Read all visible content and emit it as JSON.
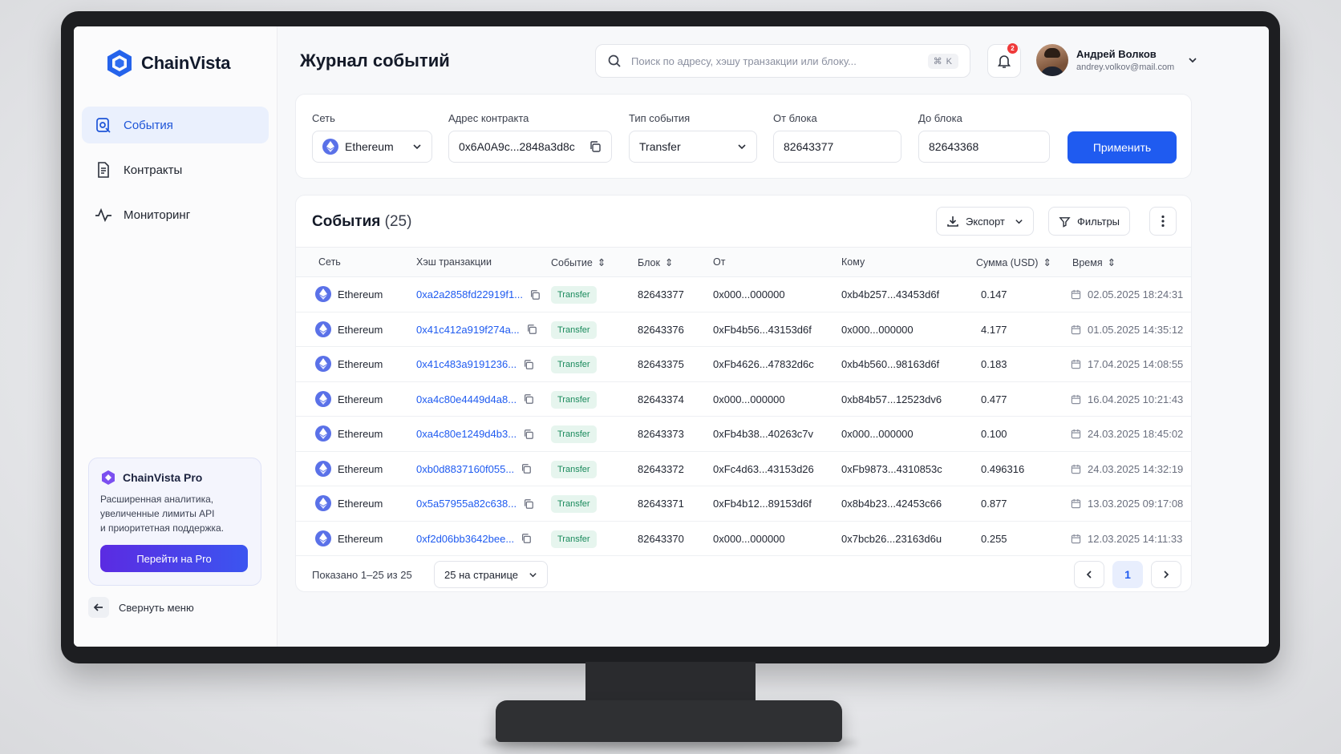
{
  "app": {
    "name": "ChainVista"
  },
  "sidebar": {
    "items": [
      {
        "label": "События",
        "icon": "events-icon",
        "active": true
      },
      {
        "label": "Контракты",
        "icon": "document-icon",
        "active": false
      },
      {
        "label": "Мониторинг",
        "icon": "activity-icon",
        "active": false
      }
    ],
    "promo": {
      "title": "ChainVista Pro",
      "line1": "Расширенная аналитика,",
      "line2": "увеличенные лимиты API",
      "line3": "и приоритетная поддержка.",
      "button": "Перейти на Pro"
    },
    "collapse_label": "Свернуть меню"
  },
  "header": {
    "title": "Журнал событий",
    "search_placeholder": "Поиск по адресу, хэшу транзакции или блоку...",
    "search_shortcut": "⌘ K",
    "notifications_count": "2",
    "user_name": "Андрей Волков",
    "user_email": "andrey.volkov@mail.com"
  },
  "filters": {
    "network_label": "Сеть",
    "network_value": "Ethereum",
    "contract_label": "Адрес контракта",
    "contract_value": "0x6A0A9c...2848a3d8c",
    "event_type_label": "Тип события",
    "event_type_value": "Transfer",
    "from_block_label": "От блока",
    "from_block_value": "82643377",
    "to_block_label": "До блока",
    "to_block_value": "82643368",
    "apply_label": "Применить"
  },
  "table": {
    "title": "События",
    "count": "(25)",
    "export_label": "Экспорт",
    "filters_label": "Фильтры",
    "columns": [
      "Сеть",
      "Хэш транзакции",
      "Событие",
      "Блок",
      "От",
      "Кому",
      "Сумма (USD)",
      "Время"
    ],
    "rows": [
      {
        "network": "Ethereum",
        "hash": "0xa2a2858fd22919f1...",
        "event": "Transfer",
        "block": "82643377",
        "from": "0x000...000000",
        "to": "0xb4b257...43453d6f",
        "amount": "0.147",
        "time": "02.05.2025 18:24:31"
      },
      {
        "network": "Ethereum",
        "hash": "0x41c412a919f274a...",
        "event": "Transfer",
        "block": "82643376",
        "from": "0xFb4b56...43153d6f",
        "to": "0x000...000000",
        "amount": "4.177",
        "time": "01.05.2025 14:35:12"
      },
      {
        "network": "Ethereum",
        "hash": "0x41c483a9191236...",
        "event": "Transfer",
        "block": "82643375",
        "from": "0xFb4626...47832d6c",
        "to": "0xb4b560...98163d6f",
        "amount": "0.183",
        "time": "17.04.2025 14:08:55"
      },
      {
        "network": "Ethereum",
        "hash": "0xa4c80e4449d4a8...",
        "event": "Transfer",
        "block": "82643374",
        "from": "0x000...000000",
        "to": "0xb84b57...12523dv6",
        "amount": "0.477",
        "time": "16.04.2025 10:21:43"
      },
      {
        "network": "Ethereum",
        "hash": "0xa4c80e1249d4b3...",
        "event": "Transfer",
        "block": "82643373",
        "from": "0xFb4b38...40263c7v",
        "to": "0x000...000000",
        "amount": "0.100",
        "time": "24.03.2025 18:45:02"
      },
      {
        "network": "Ethereum",
        "hash": "0xb0d8837160f055...",
        "event": "Transfer",
        "block": "82643372",
        "from": "0xFc4d63...43153d26",
        "to": "0xFb9873...4310853c",
        "amount": "0.496316",
        "time": "24.03.2025 14:32:19"
      },
      {
        "network": "Ethereum",
        "hash": "0x5a57955a82c638...",
        "event": "Transfer",
        "block": "82643371",
        "from": "0xFb4b12...89153d6f",
        "to": "0x8b4b23...42453c66",
        "amount": "0.877",
        "time": "13.03.2025 09:17:08"
      },
      {
        "network": "Ethereum",
        "hash": "0xf2d06bb3642bee...",
        "event": "Transfer",
        "block": "82643370",
        "from": "0x000...000000",
        "to": "0x7bcb26...23163d6u",
        "amount": "0.255",
        "time": "12.03.2025 14:11:33"
      }
    ],
    "footer": {
      "shown": "Показано 1–25 из 25",
      "per_page": "25 на странице",
      "current_page": "1"
    }
  },
  "colors": {
    "accent": "#1f5bf0",
    "pro": "#5b2be2",
    "tag_bg": "#e6f5ee",
    "tag_text": "#1a8a5c"
  }
}
